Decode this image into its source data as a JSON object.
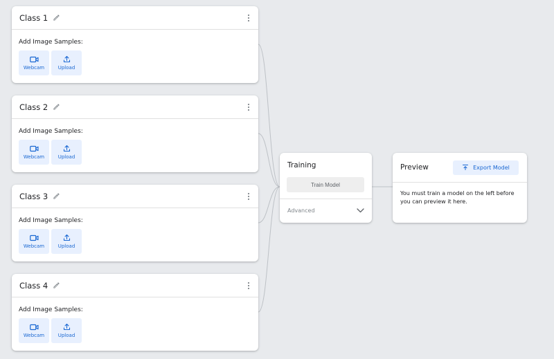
{
  "classes": [
    {
      "name": "Class 1",
      "samples_label": "Add Image Samples:",
      "webcam_label": "Webcam",
      "upload_label": "Upload"
    },
    {
      "name": "Class 2",
      "samples_label": "Add Image Samples:",
      "webcam_label": "Webcam",
      "upload_label": "Upload"
    },
    {
      "name": "Class 3",
      "samples_label": "Add Image Samples:",
      "webcam_label": "Webcam",
      "upload_label": "Upload"
    },
    {
      "name": "Class 4",
      "samples_label": "Add Image Samples:",
      "webcam_label": "Webcam",
      "upload_label": "Upload"
    }
  ],
  "training": {
    "title": "Training",
    "train_button_label": "Train Model",
    "advanced_label": "Advanced"
  },
  "preview": {
    "title": "Preview",
    "export_button_label": "Export Model",
    "message": "You must train a model on the left before you can preview it here."
  },
  "icons": {
    "edit": "pencil-icon",
    "menu": "more-vert-icon",
    "webcam": "videocam-icon",
    "upload": "upload-icon",
    "expand": "chevron-down-icon",
    "export": "export-icon"
  },
  "colors": {
    "background": "#e8eaed",
    "accent": "#1967d2",
    "accent_light": "#e8f0fe",
    "card": "#ffffff"
  }
}
